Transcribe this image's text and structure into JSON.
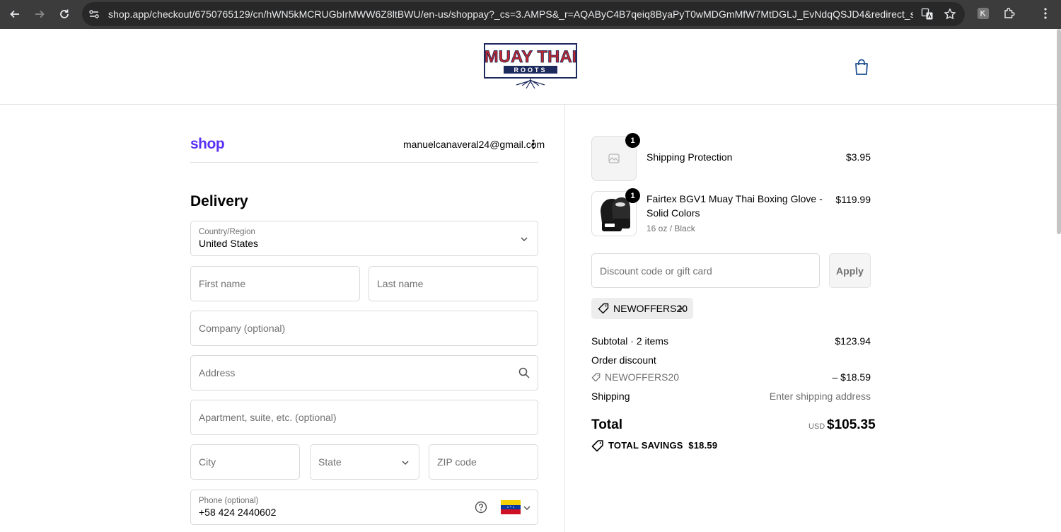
{
  "browser": {
    "url": "shop.app/checkout/6750765129/cn/hWN5kMCRUGbIrMWW6Z8ltBWU/en-us/shoppay?_cs=3.AMPS&_r=AQAByC4B7qeiq8ByaPyT0wMDGmMfW7MtDGLJ_EvNdqQSJD4&redirect_source..."
  },
  "header": {
    "logo_line1": "MUAY THAI",
    "logo_line2": "ROOTS"
  },
  "account": {
    "brand": "shop",
    "email": "manuelcanaveral24@gmail.com"
  },
  "delivery": {
    "heading": "Delivery",
    "country_label": "Country/Region",
    "country_value": "United States",
    "first_name_placeholder": "First name",
    "last_name_placeholder": "Last name",
    "company_placeholder": "Company (optional)",
    "address_placeholder": "Address",
    "apartment_placeholder": "Apartment, suite, etc. (optional)",
    "city_placeholder": "City",
    "state_placeholder": "State",
    "zip_placeholder": "ZIP code",
    "phone_label": "Phone (optional)",
    "phone_value": "+58 424 2440602"
  },
  "cart": {
    "items": [
      {
        "quantity": "1",
        "name": "Shipping Protection",
        "variant": "",
        "price": "$3.95"
      },
      {
        "quantity": "1",
        "name": "Fairtex BGV1 Muay Thai Boxing Glove - Solid Colors",
        "variant": "16 oz / Black",
        "price": "$119.99"
      }
    ],
    "discount_placeholder": "Discount code or gift card",
    "apply_label": "Apply",
    "applied_code": "NEWOFFERS20"
  },
  "summary": {
    "subtotal_label": "Subtotal · 2 items",
    "subtotal_value": "$123.94",
    "order_discount_label": "Order discount",
    "discount_code": "NEWOFFERS20",
    "discount_value": "– $18.59",
    "shipping_label": "Shipping",
    "shipping_value": "Enter shipping address",
    "total_label": "Total",
    "currency": "USD",
    "total_value": "$105.35",
    "savings_label": "TOTAL SAVINGS",
    "savings_value": "$18.59"
  },
  "colors": {
    "shop_brand": "#5a31f4",
    "logo_red": "#c0282d",
    "logo_navy": "#1d2a5e"
  }
}
